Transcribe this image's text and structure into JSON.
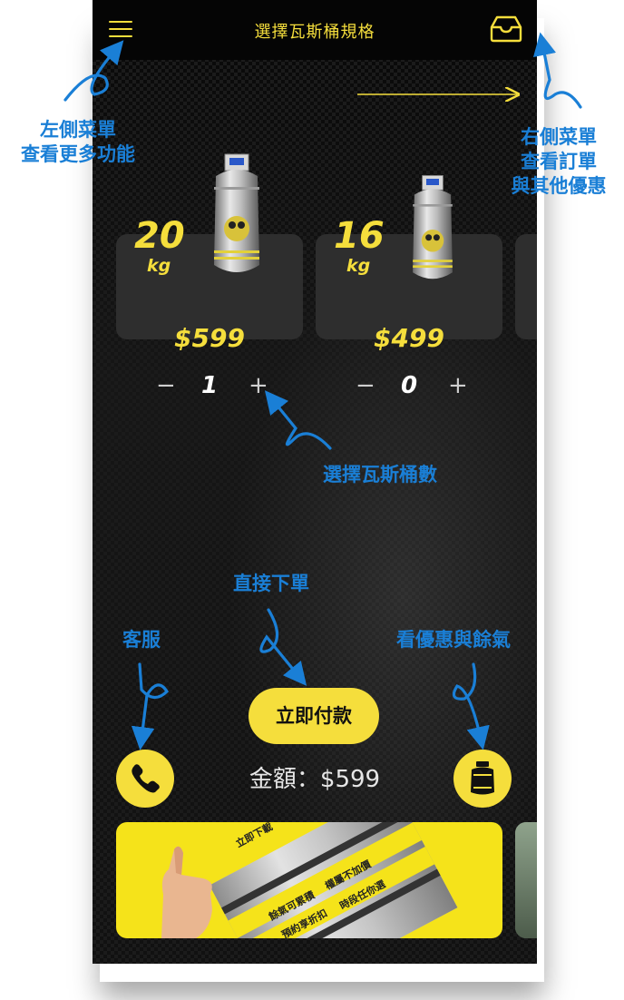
{
  "header": {
    "title": "選擇瓦斯桶規格",
    "menu_icon": "hamburger-icon",
    "inbox_icon": "inbox-icon"
  },
  "products": [
    {
      "weight": "20",
      "unit": "kg",
      "price": "$599",
      "quantity": "1",
      "minus": "−",
      "plus": "+"
    },
    {
      "weight": "16",
      "unit": "kg",
      "price": "$499",
      "quantity": "0",
      "minus": "−",
      "plus": "+"
    }
  ],
  "checkout": {
    "pay_label": "立即付款",
    "total_label": "金額：$599"
  },
  "banner": {
    "stripe_lines": [
      "立即下載",
      "餘氣可累積",
      "權屬不加價",
      "預約享折扣",
      "時段任你選"
    ]
  },
  "annotations": {
    "left_menu": "左側菜單\n查看更多功能",
    "right_menu": "右側菜單\n查看訂單\n與其他優惠",
    "select_qty": "選擇瓦斯桶數",
    "order_now": "直接下單",
    "customer_service": "客服",
    "discounts_gas": "看優惠與餘氣"
  },
  "colors": {
    "accent": "#f5de3c",
    "annotation": "#1a7fd6",
    "background": "#141414",
    "card": "#2e2e2e"
  }
}
